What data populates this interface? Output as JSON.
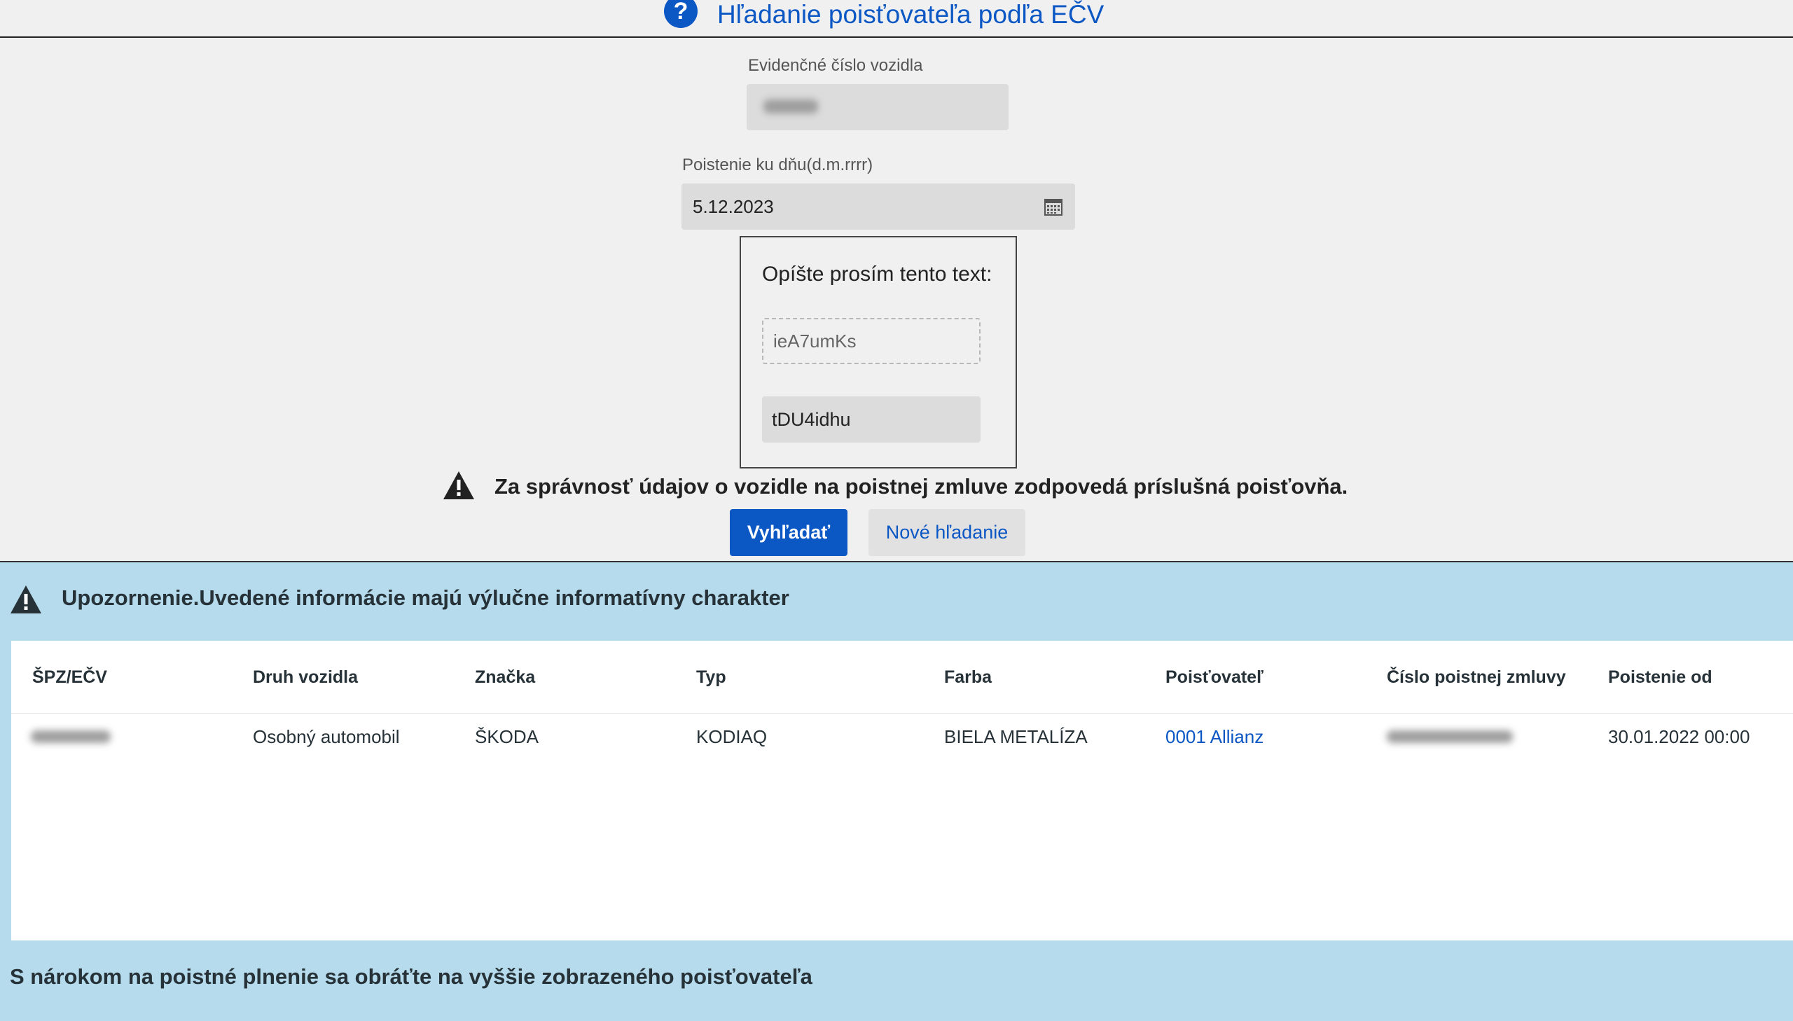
{
  "header": {
    "title": "Hľadanie poisťovateľa podľa EČV"
  },
  "form": {
    "ecv_label": "Evidenčné číslo vozidla",
    "date_label": "Poistenie ku dňu(d.m.rrrr)",
    "date_value": "5.12.2023",
    "captcha": {
      "label": "Opíšte prosím tento text:",
      "code": "ieA7umKs",
      "input_value": "tDU4idhu"
    },
    "warning": "Za správnosť údajov o vozidle na poistnej zmluve zodpovedá príslušná poisťovňa.",
    "search_button": "Vyhľadať",
    "new_search_button": "Nové hľadanie"
  },
  "results": {
    "notice": "Upozornenie.Uvedené informácie majú výlučne informatívny charakter",
    "columns": [
      "ŠPZ/EČV",
      "Druh vozidla",
      "Značka",
      "Typ",
      "Farba",
      "Poisťovateľ",
      "Číslo poistnej zmluvy",
      "Poistenie od"
    ],
    "rows": [
      {
        "druh": "Osobný automobil",
        "znacka": "ŠKODA",
        "typ": "KODIAQ",
        "farba": "BIELA METALÍZA",
        "poistovatel": "0001 Allianz",
        "poistenie_od": "30.01.2022 00:00"
      }
    ],
    "footer": "S nárokom na poistné plnenie sa obráťte na vyššie zobrazeného poisťovateľa"
  },
  "colors": {
    "brand": "#0b57c4",
    "results_bg": "#b5dbec"
  }
}
